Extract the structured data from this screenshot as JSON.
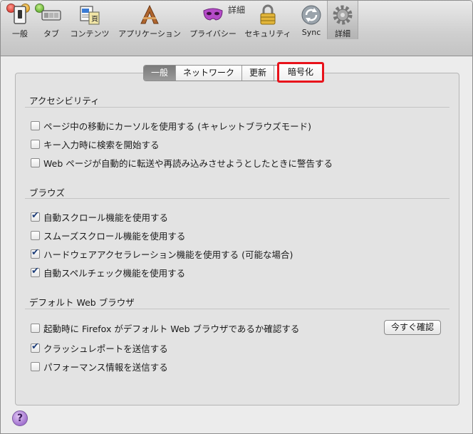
{
  "window": {
    "title": "詳細"
  },
  "toolbar": {
    "items": [
      {
        "label": "一般",
        "icon": "general-switch-icon"
      },
      {
        "label": "タブ",
        "icon": "tabs-icon"
      },
      {
        "label": "コンテンツ",
        "icon": "content-icon"
      },
      {
        "label": "アプリケーション",
        "icon": "applications-icon"
      },
      {
        "label": "プライバシー",
        "icon": "privacy-mask-icon"
      },
      {
        "label": "セキュリティ",
        "icon": "security-lock-icon"
      },
      {
        "label": "Sync",
        "icon": "sync-icon"
      },
      {
        "label": "詳細",
        "icon": "advanced-gear-icon"
      }
    ]
  },
  "tabs": [
    {
      "label": "一般",
      "active": true
    },
    {
      "label": "ネットワーク"
    },
    {
      "label": "更新"
    },
    {
      "label": "暗号化",
      "highlighted": true
    }
  ],
  "sections": {
    "accessibility": {
      "title": "アクセシビリティ",
      "options": [
        {
          "label": "ページ中の移動にカーソルを使用する (キャレットブラウズモード)",
          "checked": false
        },
        {
          "label": "キー入力時に検索を開始する",
          "checked": false
        },
        {
          "label": "Web ページが自動的に転送や再読み込みさせようとしたときに警告する",
          "checked": false
        }
      ]
    },
    "browse": {
      "title": "ブラウズ",
      "options": [
        {
          "label": "自動スクロール機能を使用する",
          "checked": true
        },
        {
          "label": "スムーズスクロール機能を使用する",
          "checked": false
        },
        {
          "label": "ハードウェアアクセラレーション機能を使用する (可能な場合)",
          "checked": true
        },
        {
          "label": "自動スペルチェック機能を使用する",
          "checked": true
        }
      ]
    },
    "default_browser": {
      "title": "デフォルト Web ブラウザ",
      "options": [
        {
          "label": "起動時に Firefox がデフォルト Web ブラウザであるか確認する",
          "checked": false
        },
        {
          "label": "クラッシュレポートを送信する",
          "checked": true
        },
        {
          "label": "パフォーマンス情報を送信する",
          "checked": false
        }
      ],
      "check_now_label": "今すぐ確認"
    }
  },
  "help": {
    "label": "?"
  },
  "colors": {
    "highlight": "#e8121b",
    "checkmark": "#1f3f7a"
  }
}
